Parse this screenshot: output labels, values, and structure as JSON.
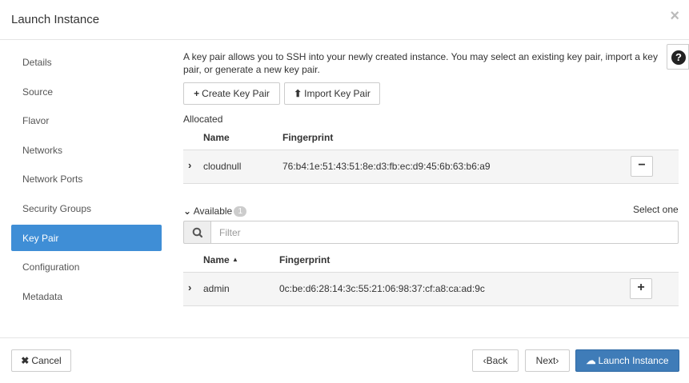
{
  "dialog": {
    "title": "Launch Instance",
    "close_glyph": "×"
  },
  "sidebar": {
    "items": [
      {
        "label": "Details"
      },
      {
        "label": "Source"
      },
      {
        "label": "Flavor"
      },
      {
        "label": "Networks"
      },
      {
        "label": "Network Ports"
      },
      {
        "label": "Security Groups"
      },
      {
        "label": "Key Pair",
        "active": true
      },
      {
        "label": "Configuration"
      },
      {
        "label": "Metadata"
      }
    ]
  },
  "main": {
    "description": "A key pair allows you to SSH into your newly created instance. You may select an existing key pair, import a key pair, or generate a new key pair.",
    "help_glyph": "?",
    "buttons": {
      "create": "Create Key Pair",
      "import": "Import Key Pair"
    },
    "allocated": {
      "label": "Allocated",
      "columns": {
        "name": "Name",
        "fingerprint": "Fingerprint"
      },
      "rows": [
        {
          "name": "cloudnull",
          "fingerprint": "76:b4:1e:51:43:51:8e:d3:fb:ec:d9:45:6b:63:b6:a9"
        }
      ]
    },
    "available": {
      "label": "Available",
      "count": "1",
      "select_hint": "Select one",
      "filter_placeholder": "Filter",
      "columns": {
        "name": "Name",
        "fingerprint": "Fingerprint"
      },
      "rows": [
        {
          "name": "admin",
          "fingerprint": "0c:be:d6:28:14:3c:55:21:06:98:37:cf:a8:ca:ad:9c"
        }
      ]
    }
  },
  "footer": {
    "cancel": "Cancel",
    "back": "Back",
    "next": "Next",
    "launch": "Launch Instance"
  },
  "colors": {
    "accent": "#3f8ed6",
    "primary_button": "#3f7cb8"
  }
}
